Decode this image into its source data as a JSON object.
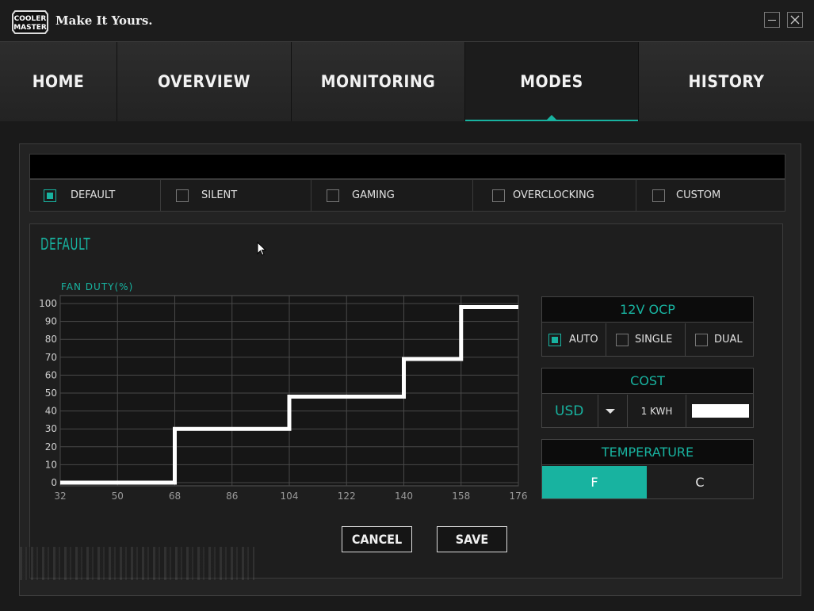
{
  "app": {
    "brand_line1": "COOLER",
    "brand_line2": "MASTER",
    "tagline": "Make It Yours."
  },
  "window": {
    "minimize_icon": "minimize-icon",
    "close_icon": "close-icon"
  },
  "nav": {
    "tabs": [
      {
        "label": "HOME",
        "active": false
      },
      {
        "label": "OVERVIEW",
        "active": false
      },
      {
        "label": "MONITORING",
        "active": false
      },
      {
        "label": "MODES",
        "active": true
      },
      {
        "label": "HISTORY",
        "active": false
      }
    ]
  },
  "modes": {
    "options": [
      {
        "label": "DEFAULT",
        "checked": true
      },
      {
        "label": "SILENT",
        "checked": false
      },
      {
        "label": "GAMING",
        "checked": false
      },
      {
        "label": "OVERCLOCKING",
        "checked": false
      },
      {
        "label": "CUSTOM",
        "checked": false
      }
    ]
  },
  "panel": {
    "title": "DEFAULT",
    "fan_label": "FAN DUTY(%)"
  },
  "chart_data": {
    "type": "line",
    "step": true,
    "ylabel": "FAN DUTY(%)",
    "x_ticks": [
      32,
      50,
      68,
      86,
      104,
      122,
      140,
      158,
      176
    ],
    "y_ticks": [
      0,
      10,
      20,
      30,
      40,
      50,
      60,
      70,
      80,
      90,
      100
    ],
    "xlim": [
      32,
      176
    ],
    "ylim": [
      0,
      100
    ],
    "grid": true,
    "series": [
      {
        "points": [
          [
            32,
            0
          ],
          [
            68,
            0
          ],
          [
            68,
            30
          ],
          [
            104,
            30
          ],
          [
            104,
            48
          ],
          [
            140,
            48
          ],
          [
            140,
            69
          ],
          [
            158,
            69
          ],
          [
            158,
            98
          ],
          [
            176,
            98
          ]
        ]
      }
    ]
  },
  "ocp": {
    "title": "12V OCP",
    "options": [
      {
        "label": "AUTO",
        "checked": true
      },
      {
        "label": "SINGLE",
        "checked": false
      },
      {
        "label": "DUAL",
        "checked": false
      }
    ]
  },
  "cost": {
    "title": "COST",
    "currency": "USD",
    "unit": "1 KWH",
    "value": ""
  },
  "temperature": {
    "title": "TEMPERATURE",
    "f": "F",
    "c": "C",
    "selected": "F"
  },
  "actions": {
    "cancel": "CANCEL",
    "save": "SAVE"
  },
  "colors": {
    "accent": "#18b3a0",
    "background": "#1a1a1a"
  }
}
